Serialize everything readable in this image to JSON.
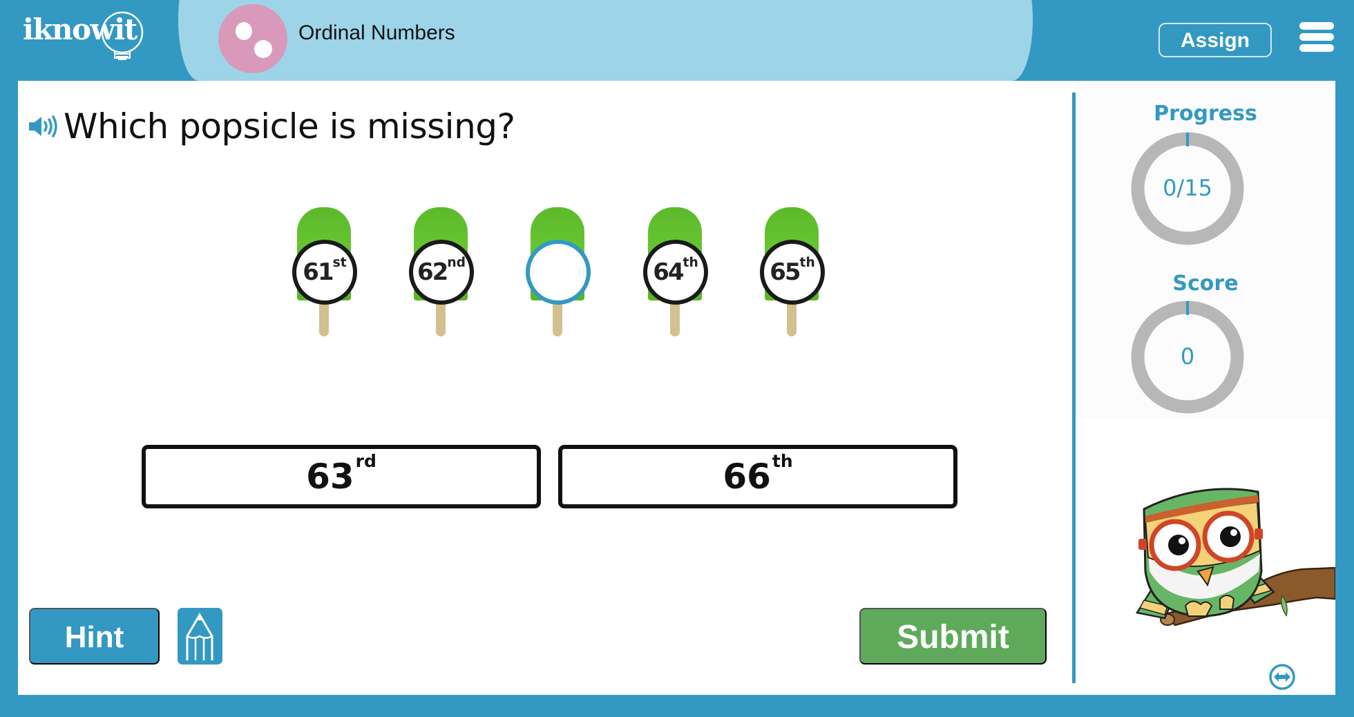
{
  "header": {
    "logo_text": "iknowit",
    "topic_title": "Ordinal Numbers",
    "assign_label": "Assign",
    "menu_icon": "hamburger-menu-icon"
  },
  "question": {
    "speaker_icon": "speaker-icon",
    "text": "Which popsicle is missing?"
  },
  "popsicles": [
    {
      "number": "61",
      "suffix": "st",
      "missing": false
    },
    {
      "number": "62",
      "suffix": "nd",
      "missing": false
    },
    {
      "number": "",
      "suffix": "",
      "missing": true
    },
    {
      "number": "64",
      "suffix": "th",
      "missing": false
    },
    {
      "number": "65",
      "suffix": "th",
      "missing": false
    }
  ],
  "answers": [
    {
      "number": "63",
      "suffix": "rd"
    },
    {
      "number": "66",
      "suffix": "th"
    }
  ],
  "buttons": {
    "hint_label": "Hint",
    "pencil_icon": "pencil-icon",
    "submit_label": "Submit"
  },
  "stats": {
    "progress_title": "Progress",
    "progress_value": "0/15",
    "progress_fraction": 0,
    "score_title": "Score",
    "score_value": "0",
    "score_fraction": 0
  },
  "colors": {
    "brand_blue": "#3399c2",
    "header_light_blue": "#9dd4e8",
    "topic_pink": "#d999bb",
    "submit_green": "#5faa5a",
    "popsicle_green": "#62bf2f",
    "ring_grey": "#b7b7b7"
  }
}
